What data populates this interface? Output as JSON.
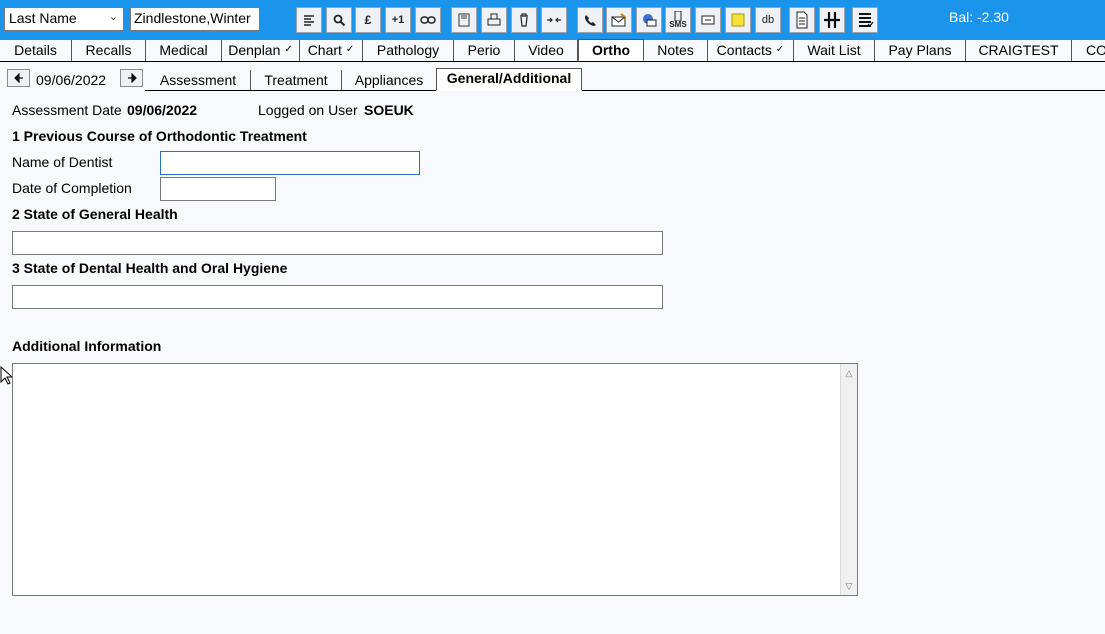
{
  "toolbar": {
    "search_field": "Last Name",
    "patient_name": "Zindlestone,Winter",
    "balance": "Bal: -2.30",
    "plus_one_label": "+1",
    "pound_label": "£",
    "db_label": "db",
    "sms_label": "SMS"
  },
  "main_tabs": [
    {
      "label": "Details"
    },
    {
      "label": "Recalls"
    },
    {
      "label": "Medical"
    },
    {
      "label": "Denplan",
      "tick": "✓"
    },
    {
      "label": "Chart",
      "tick": "✓"
    },
    {
      "label": "Pathology"
    },
    {
      "label": "Perio"
    },
    {
      "label": "Video"
    },
    {
      "label": "Ortho"
    },
    {
      "label": "Notes"
    },
    {
      "label": "Contacts",
      "tick": "✓"
    },
    {
      "label": "Wait List"
    },
    {
      "label": "Pay Plans"
    },
    {
      "label": "CRAIGTEST"
    },
    {
      "label": "CO"
    }
  ],
  "sub": {
    "date": "09/06/2022",
    "tabs": [
      "Assessment",
      "Treatment",
      "Appliances",
      "General/Additional"
    ]
  },
  "form": {
    "assessment_date_label": "Assessment Date",
    "assessment_date_value": "09/06/2022",
    "logged_on_label": "Logged on User",
    "logged_on_value": "SOEUK",
    "section1_heading": "1 Previous Course of Orthodontic Treatment",
    "name_of_dentist_label": "Name of Dentist",
    "name_of_dentist_value": "",
    "date_of_completion_label": "Date of Completion",
    "date_of_completion_value": "",
    "section2_heading": "2 State of General Health",
    "general_health_value": "",
    "section3_heading": "3 State of Dental Health and Oral Hygiene",
    "dental_health_value": "",
    "additional_heading": "Additional Information",
    "additional_value": ""
  }
}
